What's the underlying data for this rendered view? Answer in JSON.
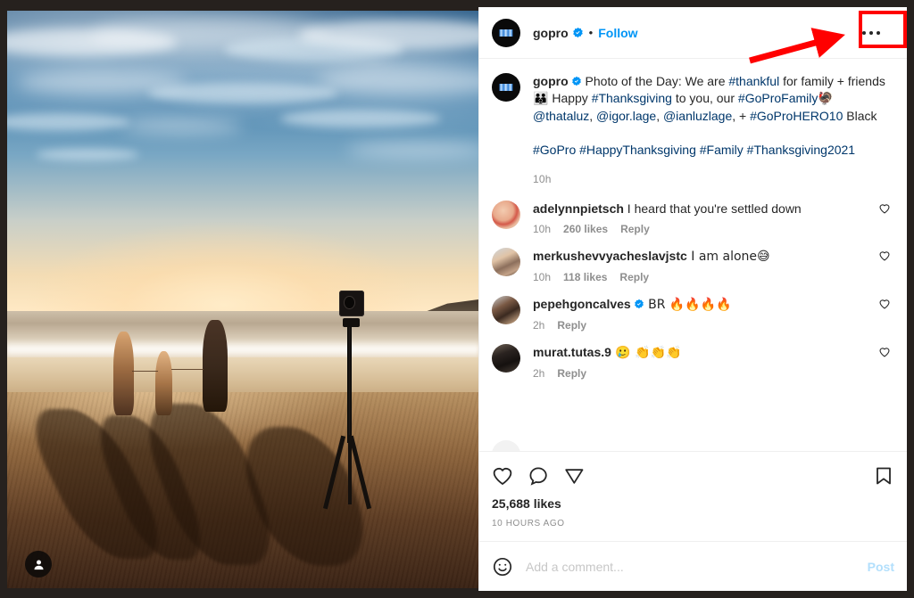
{
  "post": {
    "author": "gopro",
    "verified_icon": "verified-badge-icon",
    "follow_label": "Follow",
    "separator": "•",
    "more_icon": "more-options-icon",
    "caption": {
      "author": "gopro",
      "segments": [
        {
          "type": "text",
          "value": " Photo of the Day: We are "
        },
        {
          "type": "link",
          "value": "#thankful"
        },
        {
          "type": "text",
          "value": " for family + friends "
        },
        {
          "type": "emoji",
          "value": "👪"
        },
        {
          "type": "text",
          "value": " Happy "
        },
        {
          "type": "link",
          "value": "#Thanksgiving"
        },
        {
          "type": "text",
          "value": " to you, our "
        },
        {
          "type": "link",
          "value": "#GoProFamily"
        },
        {
          "type": "emoji",
          "value": "🦃"
        },
        {
          "type": "link",
          "value": "@thataluz"
        },
        {
          "type": "text",
          "value": ", "
        },
        {
          "type": "link",
          "value": "@igor.lage"
        },
        {
          "type": "text",
          "value": ", "
        },
        {
          "type": "link",
          "value": "@ianluzlage"
        },
        {
          "type": "text",
          "value": ", + "
        },
        {
          "type": "link",
          "value": "#GoProHERO10"
        },
        {
          "type": "text",
          "value": " Black"
        }
      ],
      "hashtag_line": "#GoPro #HappyThanksgiving #Family #Thanksgiving2021",
      "time": "10h"
    }
  },
  "comments": [
    {
      "avatar": "a1",
      "username": "adelynnpietsch",
      "verified": false,
      "text": " I heard that you're settled down",
      "time": "10h",
      "likes": "260 likes",
      "reply": "Reply",
      "like_icon": "heart-outline-icon"
    },
    {
      "avatar": "a2",
      "username": "merkushevvyacheslavjstc",
      "verified": false,
      "text": " I am alone😅",
      "time": "10h",
      "likes": "118 likes",
      "reply": "Reply",
      "like_icon": "heart-outline-icon"
    },
    {
      "avatar": "a3",
      "username": "pepehgoncalves",
      "verified": true,
      "text": " BR 🔥🔥🔥🔥",
      "time": "2h",
      "likes": "",
      "reply": "Reply",
      "like_icon": "heart-outline-icon"
    },
    {
      "avatar": "a4",
      "username": "murat.tutas.9",
      "verified": false,
      "text": " 🥲 👏👏👏",
      "time": "2h",
      "likes": "",
      "reply": "Reply",
      "like_icon": "heart-outline-icon"
    }
  ],
  "actions": {
    "like_icon": "heart-outline-icon",
    "comment_icon": "comment-bubble-icon",
    "share_icon": "share-paper-plane-icon",
    "save_icon": "bookmark-outline-icon",
    "likes_count": "25,688 likes",
    "posted_time": "10 HOURS AGO"
  },
  "add_comment": {
    "emoji_icon": "emoji-smiley-icon",
    "placeholder": "Add a comment...",
    "post_label": "Post"
  },
  "photo": {
    "badge_icon": "tagged-people-icon",
    "alt": "Family of three holding hands walking on a beach at sunset with a GoPro on a tripod"
  },
  "annotation": {
    "highlight_color": "#ff0000",
    "arrow_icon": "red-arrow-pointer",
    "target": "more-options-icon"
  },
  "colors": {
    "ig_blue": "#0095f6",
    "link_blue": "#00376b",
    "text_primary": "#262626",
    "text_secondary": "#8e8e8e",
    "post_disabled": "#b2dffc",
    "annotation_red": "#ff0000"
  }
}
